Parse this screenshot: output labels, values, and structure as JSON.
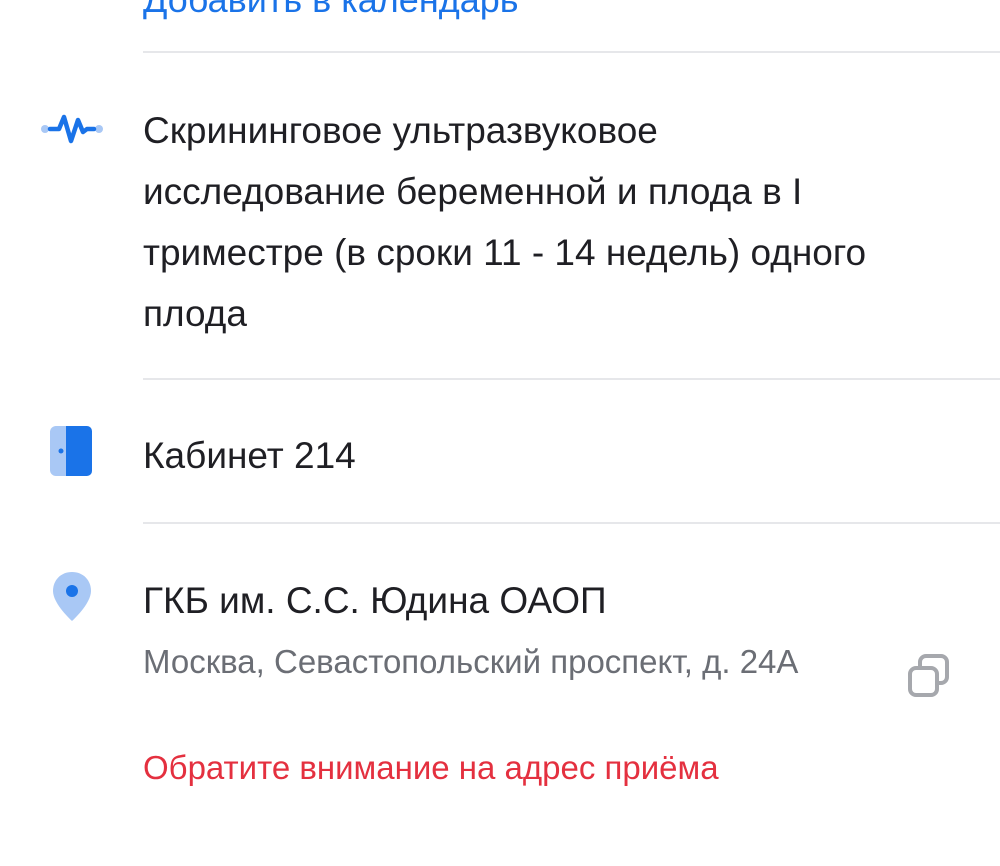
{
  "calendar": {
    "link_label": "Добавить в календарь"
  },
  "service": {
    "icon": "pulse-icon",
    "title": "Скрининговое ультразвуковое исследование беременной и плода в I триместре (в сроки 11 - 14 недель) одного плода"
  },
  "room": {
    "icon": "door-icon",
    "label": "Кабинет 214"
  },
  "clinic": {
    "icon": "location-pin-icon",
    "name": "ГКБ им. С.С. Юдина ОАОП",
    "address": "Москва, Севастопольский проспект, д. 24А",
    "warning": "Обратите внимание на адрес приёма",
    "copy_icon": "copy-icon"
  },
  "colors": {
    "accent": "#1a73e8",
    "icon_light": "#a9c8f5",
    "icon_dark": "#1a73e8",
    "warning": "#e4303f",
    "secondary_text": "#6b6e75",
    "divider": "#e6e7ea"
  }
}
